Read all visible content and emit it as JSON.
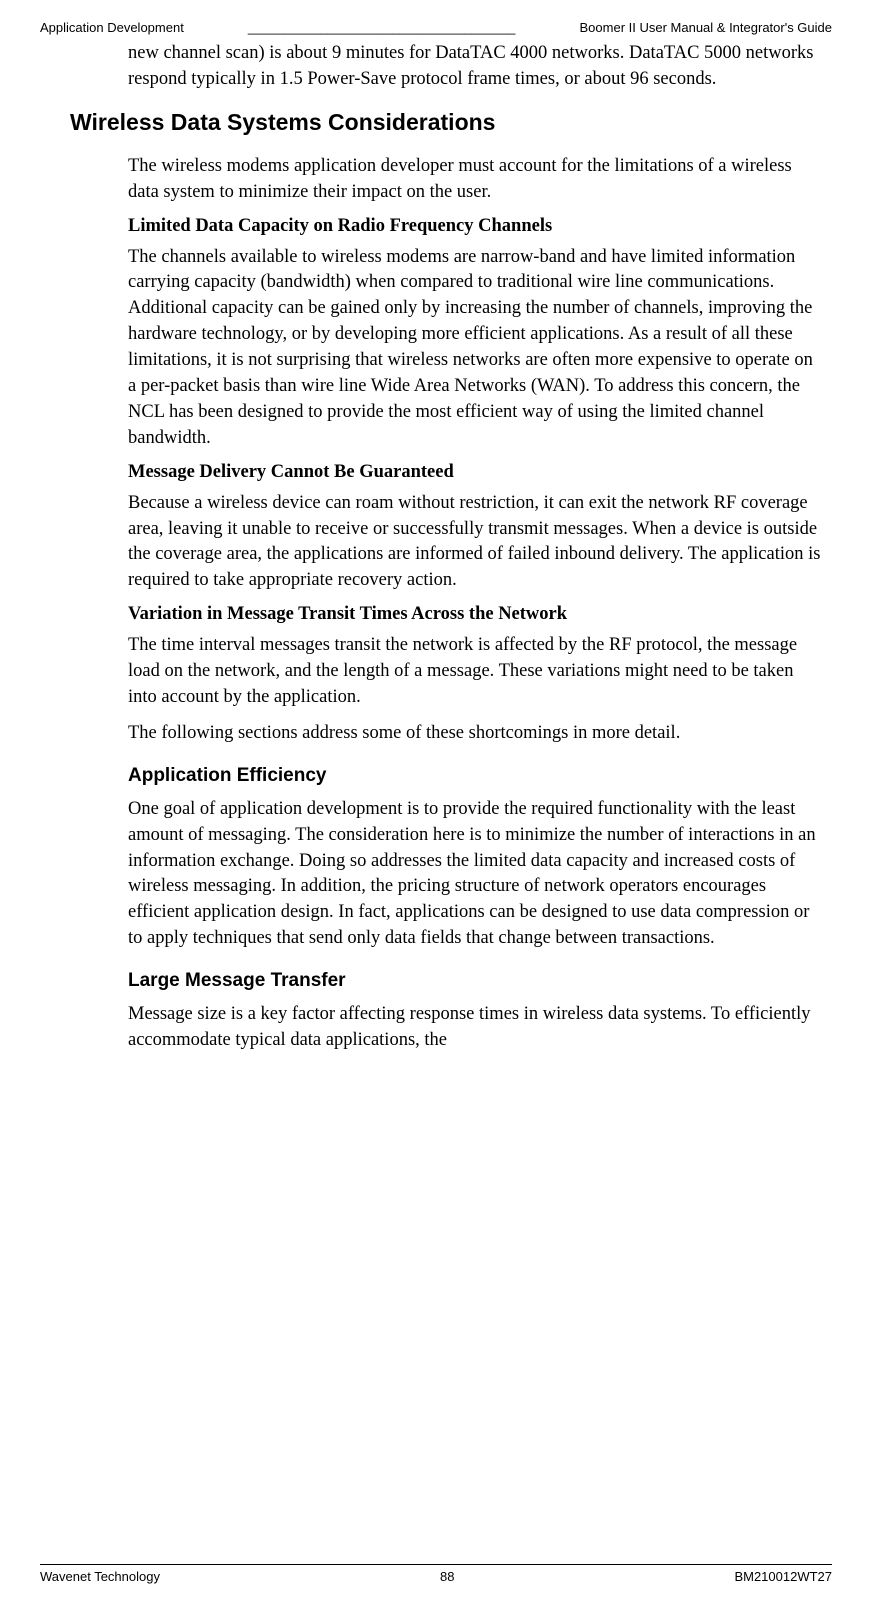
{
  "header": {
    "left": "Application Development",
    "separator": "_____________________________________",
    "right": "Boomer II User Manual & Integrator's Guide"
  },
  "content": {
    "intro_para": "new channel scan) is about 9 minutes for DataTAC 4000 networks. DataTAC 5000 networks respond typically in 1.5 Power-Save protocol frame times, or about 96 seconds.",
    "h1": "Wireless Data Systems Considerations",
    "p1": "The wireless modems application developer must account for the limitations of a wireless data system to minimize their impact on the user.",
    "b1": "Limited Data Capacity on Radio Frequency Channels",
    "p2": "The channels available to wireless modems are narrow-band and have limited information carrying capacity (bandwidth) when compared to traditional wire line communications. Additional capacity can be gained only by increasing the number of channels, improving the hardware technology, or by developing more efficient applications. As a result of all these limitations, it is not surprising that wireless networks are often more expensive to operate on a per-packet basis than wire line Wide Area Networks (WAN). To address this concern, the NCL has been designed to provide the most efficient way of using the limited channel bandwidth.",
    "b2": "Message Delivery Cannot Be Guaranteed",
    "p3": "Because a wireless device can roam without restriction, it can exit the network RF coverage area, leaving it unable to receive or successfully transmit messages. When a device is outside the coverage area, the applications are informed of failed inbound delivery. The application is required to take appropriate recovery action.",
    "b3": "Variation in Message Transit Times Across the Network",
    "p4": "The time interval messages transit the network is affected by the RF protocol, the message load on the network, and the length of a message. These variations might need to be taken into account by the application.",
    "p5": "The following sections address some of these shortcomings in more detail.",
    "h2a": "Application Efficiency",
    "p6": "One goal of application development is to provide the required functionality with the least amount of messaging. The consideration here is to minimize the number of interactions in an information exchange. Doing so addresses the limited data capacity and increased costs of wireless messaging. In addition, the pricing structure of network operators encourages efficient application design. In fact, applications can be designed to use data compression or to apply techniques that send only data fields that change between transactions.",
    "h2b": "Large Message Transfer",
    "p7": "Message size is a key factor affecting response times in wireless data systems. To efficiently accommodate typical data applications, the"
  },
  "footer": {
    "left": "Wavenet Technology",
    "center": "88",
    "right": "BM210012WT27"
  }
}
